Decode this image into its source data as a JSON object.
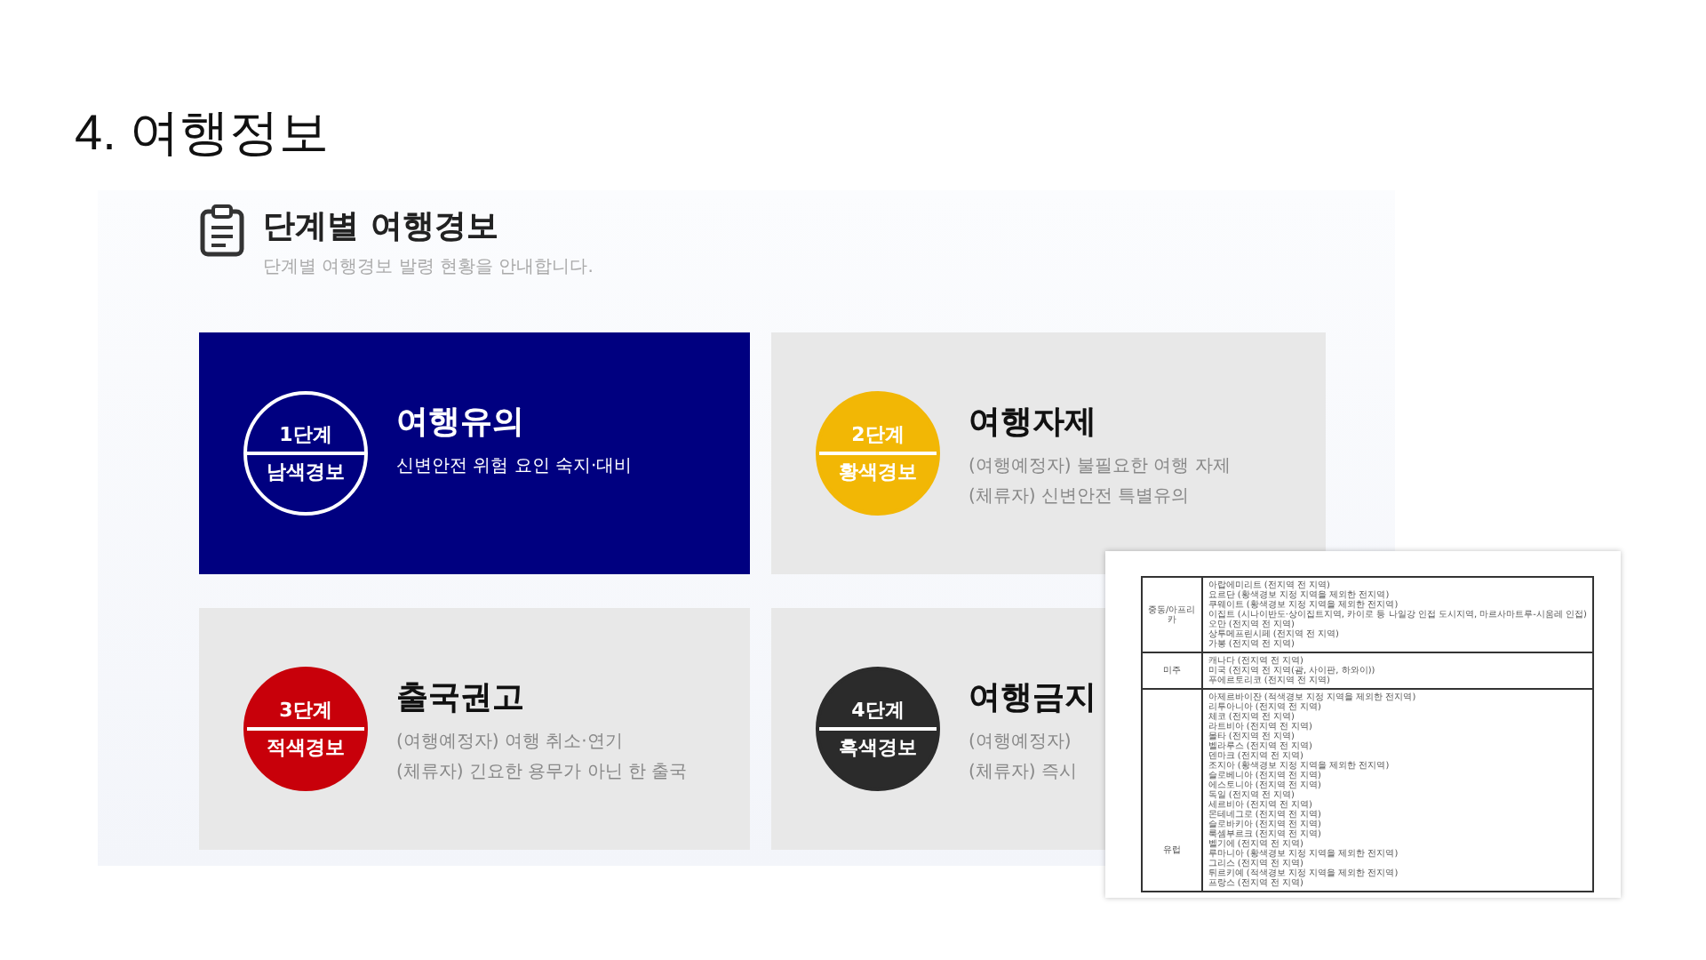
{
  "slide_title": "4. 여행정보",
  "panel": {
    "heading": "단계별 여행경보",
    "subtitle": "단계별 여행경보 발령 현황을 안내합니다.",
    "cards": [
      {
        "level_label": "1단계",
        "alert_name": "남색경보",
        "title": "여행유의",
        "lines": [
          "신변안전 위험 요인 숙지·대비"
        ],
        "color": "#000080",
        "highlighted": true
      },
      {
        "level_label": "2단계",
        "alert_name": "황색경보",
        "title": "여행자제",
        "lines": [
          "(여행예정자) 불필요한 여행 자제",
          "(체류자) 신변안전 특별유의"
        ],
        "color": "#f2b705",
        "highlighted": false
      },
      {
        "level_label": "3단계",
        "alert_name": "적색경보",
        "title": "출국권고",
        "lines": [
          "(여행예정자) 여행 취소·연기",
          "(체류자) 긴요한 용무가 아닌 한 출국"
        ],
        "color": "#c8000a",
        "highlighted": false
      },
      {
        "level_label": "4단계",
        "alert_name": "흑색경보",
        "title": "여행금지",
        "lines": [
          "(여행예정자)",
          "(체류자) 즉시"
        ],
        "color": "#2b2b2b",
        "highlighted": false
      }
    ]
  },
  "table": {
    "rows": [
      {
        "region": "중동/아프리카",
        "entries": [
          "아랍에미리트 (전지역 전 지역)",
          "요르단 (황색경보 지정 지역을 제외한 전지역)",
          "쿠웨이트 (황색경보 지정 지역을 제외한 전지역)",
          "이집트 (시나이반도·상이집트지역, 카이로 등 나일강 인접 도시지역, 마르사마트루-시움레 인접)",
          "오만 (전지역 전 지역)",
          "상투메프린시페 (전지역 전 지역)",
          "가봉 (전지역 전 지역)"
        ]
      },
      {
        "region": "미주",
        "entries": [
          "캐나다 (전지역 전 지역)",
          "미국 (전지역 전 지역(괌, 사이판, 하와이))",
          "푸에르토리코 (전지역 전 지역)"
        ]
      },
      {
        "region": "유럽",
        "entries": [
          "아제르바이잔 (적색경보 지정 지역을 제외한 전지역)",
          "리투아니아 (전지역 전 지역)",
          "체코 (전지역 전 지역)",
          "라트비아 (전지역 전 지역)",
          "몰타 (전지역 전 지역)",
          "벨라루스 (전지역 전 지역)",
          "덴마크 (전지역 전 지역)",
          "조지아 (황색경보 지정 지역을 제외한 전지역)",
          "슬로베니아 (전지역 전 지역)",
          "에스토니아 (전지역 전 지역)",
          "독일 (전지역 전 지역)",
          "세르비아 (전지역 전 지역)",
          "몬테네그로 (전지역 전 지역)",
          "슬로바키아 (전지역 전 지역)",
          "룩셈부르크 (전지역 전 지역)",
          "벨기에 (전지역 전 지역)",
          "루마니아 (황색경보 지정 지역을 제외한 전지역)",
          "그리스 (전지역 전 지역)",
          "튀르키예 (적색경보 지정 지역을 제외한 전지역)",
          "프랑스 (전지역 전 지역)"
        ]
      }
    ]
  }
}
